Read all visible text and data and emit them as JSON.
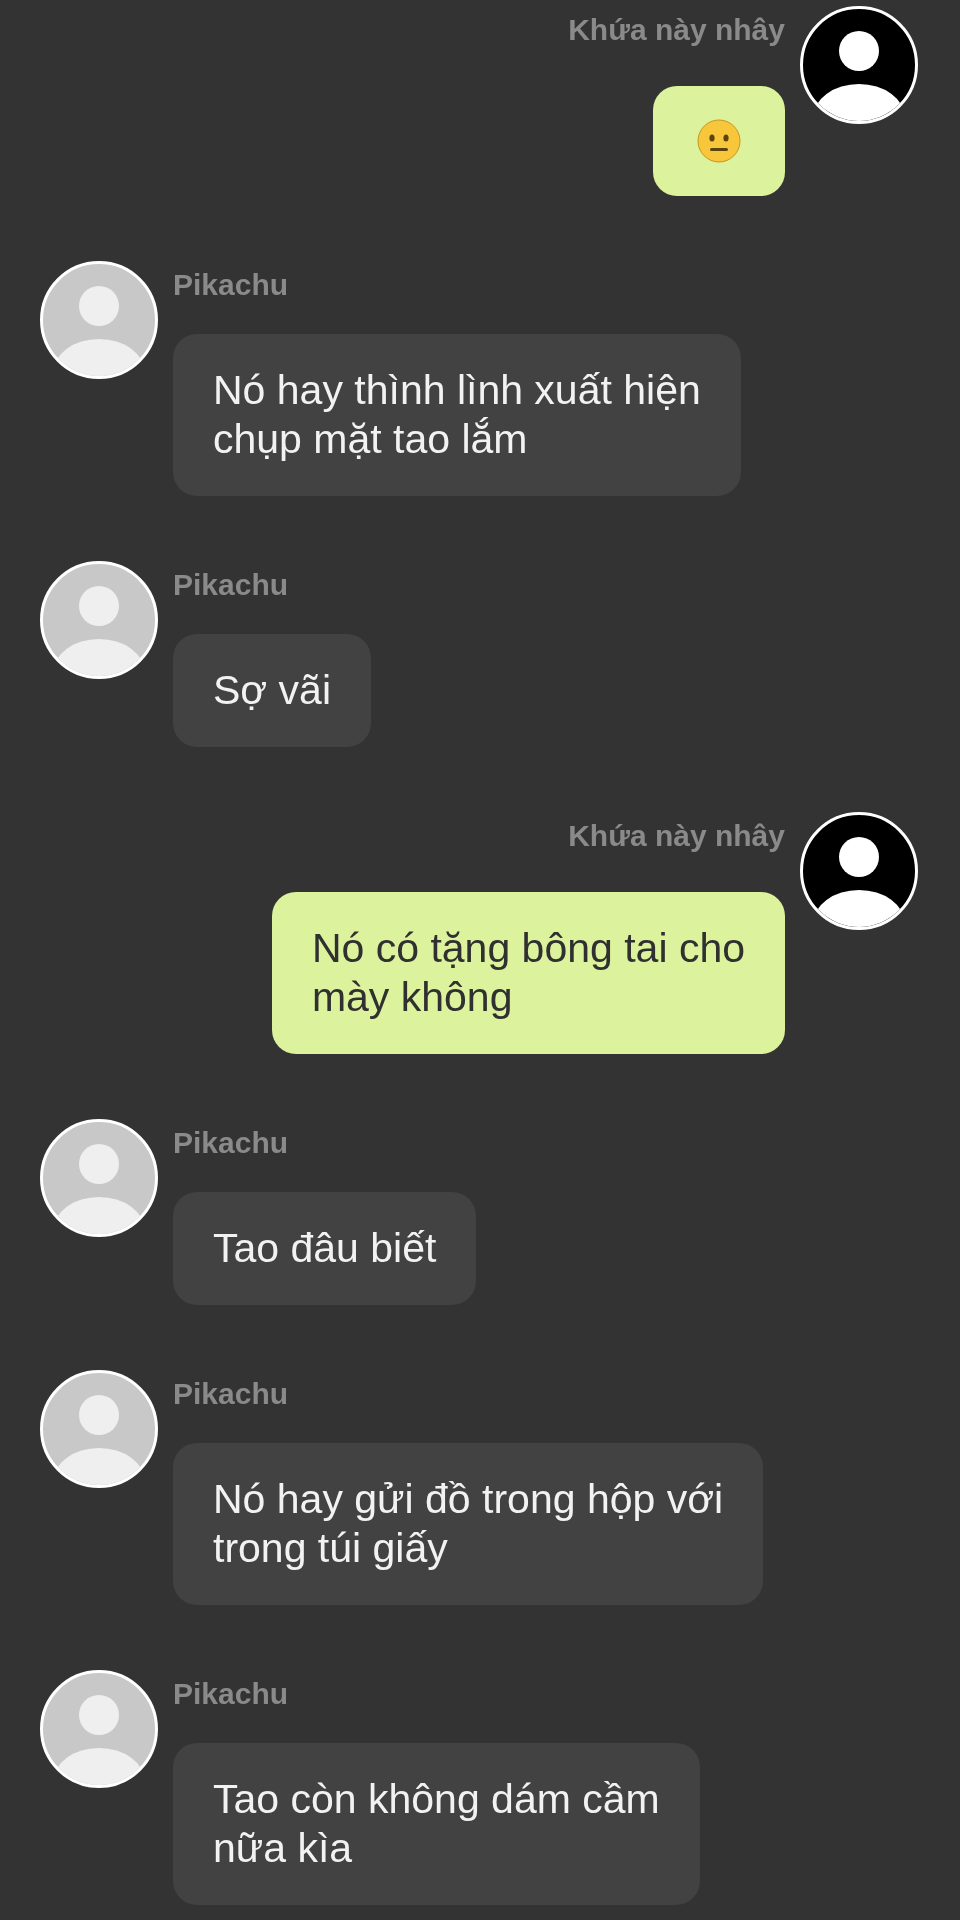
{
  "messages": [
    {
      "mine": true,
      "sender": "Khứa này nhây",
      "kind": "emoji"
    },
    {
      "mine": false,
      "sender": "Pikachu",
      "kind": "text",
      "text": "Nó hay thình lình xuất hiện\nchụp mặt tao lắm"
    },
    {
      "mine": false,
      "sender": "Pikachu",
      "kind": "text",
      "text": "Sợ vãi"
    },
    {
      "mine": true,
      "sender": "Khứa này nhây",
      "kind": "text",
      "text": "Nó có tặng bông tai cho\nmày không"
    },
    {
      "mine": false,
      "sender": "Pikachu",
      "kind": "text",
      "text": "Tao đâu biết"
    },
    {
      "mine": false,
      "sender": "Pikachu",
      "kind": "text",
      "text": "Nó hay gửi đồ trong hộp với\ntrong túi giấy"
    },
    {
      "mine": false,
      "sender": "Pikachu",
      "kind": "text",
      "text": "Tao còn không dám cầm\nnữa kìa"
    }
  ]
}
